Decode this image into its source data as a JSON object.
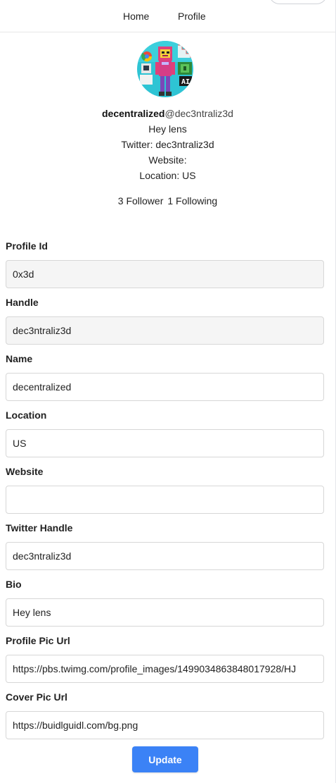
{
  "nav": {
    "home_label": "Home",
    "profile_label": "Profile"
  },
  "profile": {
    "display_name": "decentralized",
    "at_handle": "@dec3ntraliz3d",
    "bio": "Hey lens",
    "twitter_text": "Twitter: dec3ntraliz3d",
    "website_text": "Website:",
    "location_text": "Location: US",
    "followers_text": "3 Follower",
    "following_text": "1 Following"
  },
  "form": {
    "profile_id": {
      "label": "Profile Id",
      "value": "0x3d"
    },
    "handle": {
      "label": "Handle",
      "value": "dec3ntraliz3d"
    },
    "name": {
      "label": "Name",
      "value": "decentralized"
    },
    "location": {
      "label": "Location",
      "value": "US"
    },
    "website": {
      "label": "Website",
      "value": ""
    },
    "twitter": {
      "label": "Twitter Handle",
      "value": "dec3ntraliz3d"
    },
    "bio": {
      "label": "Bio",
      "value": "Hey lens"
    },
    "profile_pic": {
      "label": "Profile Pic Url",
      "value": "https://pbs.twimg.com/profile_images/1499034863848017928/HJ"
    },
    "cover_pic": {
      "label": "Cover Pic Url",
      "value": "https://buidlguidl.com/bg.png"
    },
    "update_label": "Update"
  },
  "colors": {
    "primary_button": "#3b82f6",
    "readonly_field": "#f5f5f5",
    "border": "#d7d7d7"
  }
}
